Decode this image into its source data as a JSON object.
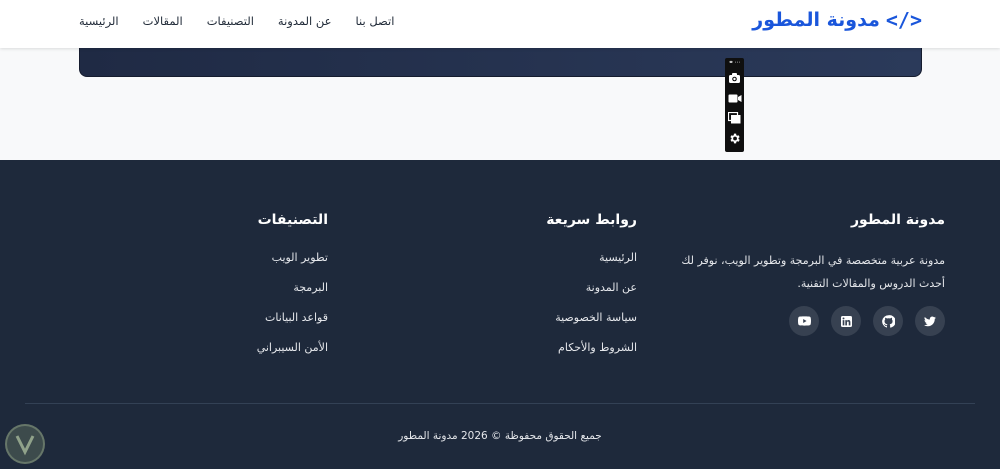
{
  "header": {
    "logo_text": "مدونة المطور",
    "logo_icon": "code-icon",
    "nav": [
      "الرئيسية",
      "المقالات",
      "التصنيفات",
      "عن المدونة",
      "اتصل بنا"
    ]
  },
  "toolbar": {
    "icons": [
      "camera-icon",
      "video-icon",
      "windows-icon",
      "settings-icon"
    ]
  },
  "footer": {
    "about": {
      "title": "مدونة المطور",
      "description": "مدونة عربية متخصصة في البرمجة وتطوير الويب، نوفر لك أحدث الدروس والمقالات التقنية.",
      "socials": [
        "twitter-icon",
        "github-icon",
        "linkedin-icon",
        "youtube-icon"
      ]
    },
    "quick_links": {
      "title": "روابط سريعة",
      "items": [
        "الرئيسية",
        "عن المدونة",
        "سياسة الخصوصية",
        "الشروط والأحكام"
      ]
    },
    "categories": {
      "title": "التصنيفات",
      "items": [
        "تطوير الويب",
        "البرمجة",
        "قواعد البيانات",
        "الأمن السيبراني"
      ]
    },
    "copyright": "جميع الحقوق محفوظة © 2026 مدونة المطور"
  },
  "colors": {
    "brand": "#1a56db",
    "footer_bg": "#1e293b",
    "banner_bg": "#1f2a44"
  }
}
